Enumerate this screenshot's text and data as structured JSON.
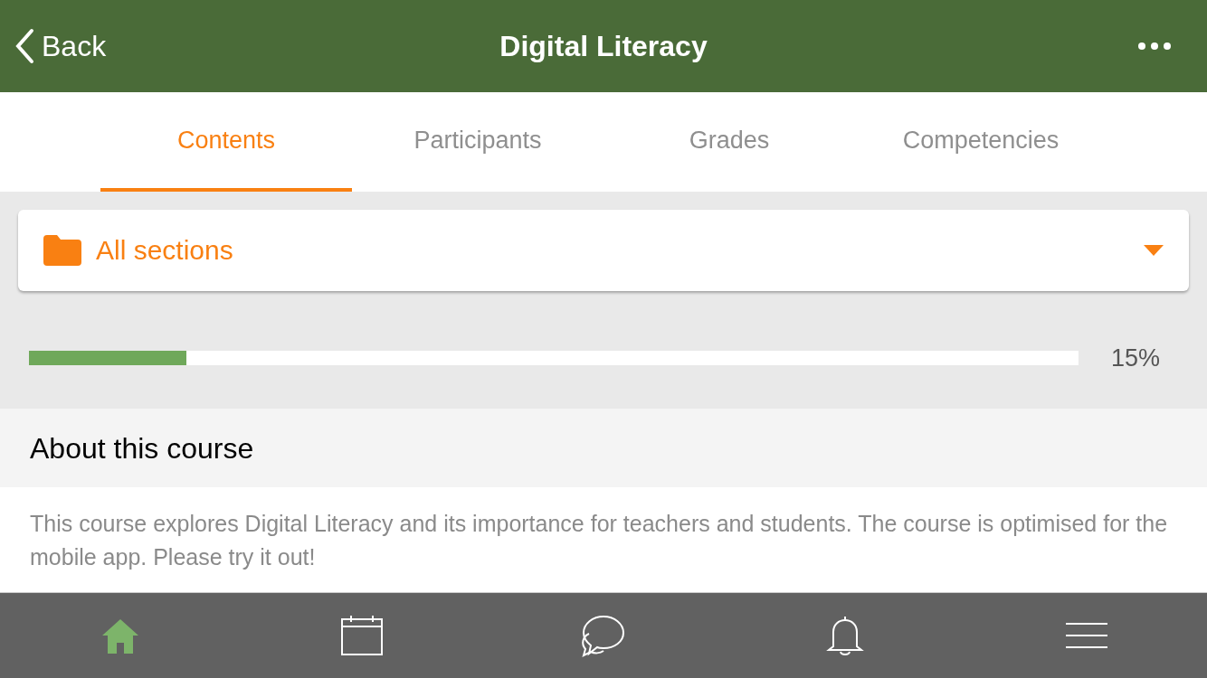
{
  "header": {
    "back_label": "Back",
    "title": "Digital Literacy"
  },
  "tabs": [
    {
      "label": "Contents",
      "selected": true
    },
    {
      "label": "Participants",
      "selected": false
    },
    {
      "label": "Grades",
      "selected": false
    },
    {
      "label": "Competencies",
      "selected": false
    }
  ],
  "section_selector": {
    "value": "All sections"
  },
  "progress": {
    "level": 0.15,
    "reading": "15%"
  },
  "about": {
    "heading": "About this course",
    "text": "This course explores Digital Literacy and its importance for teachers and students. The course is optimised for the mobile app. Please try it out!"
  },
  "bottom_nav": [
    {
      "kind": "home",
      "selected": true
    },
    {
      "kind": "calendar",
      "selected": false
    },
    {
      "kind": "messages",
      "selected": false
    },
    {
      "kind": "notifications",
      "selected": false
    },
    {
      "kind": "menu",
      "selected": false
    }
  ]
}
